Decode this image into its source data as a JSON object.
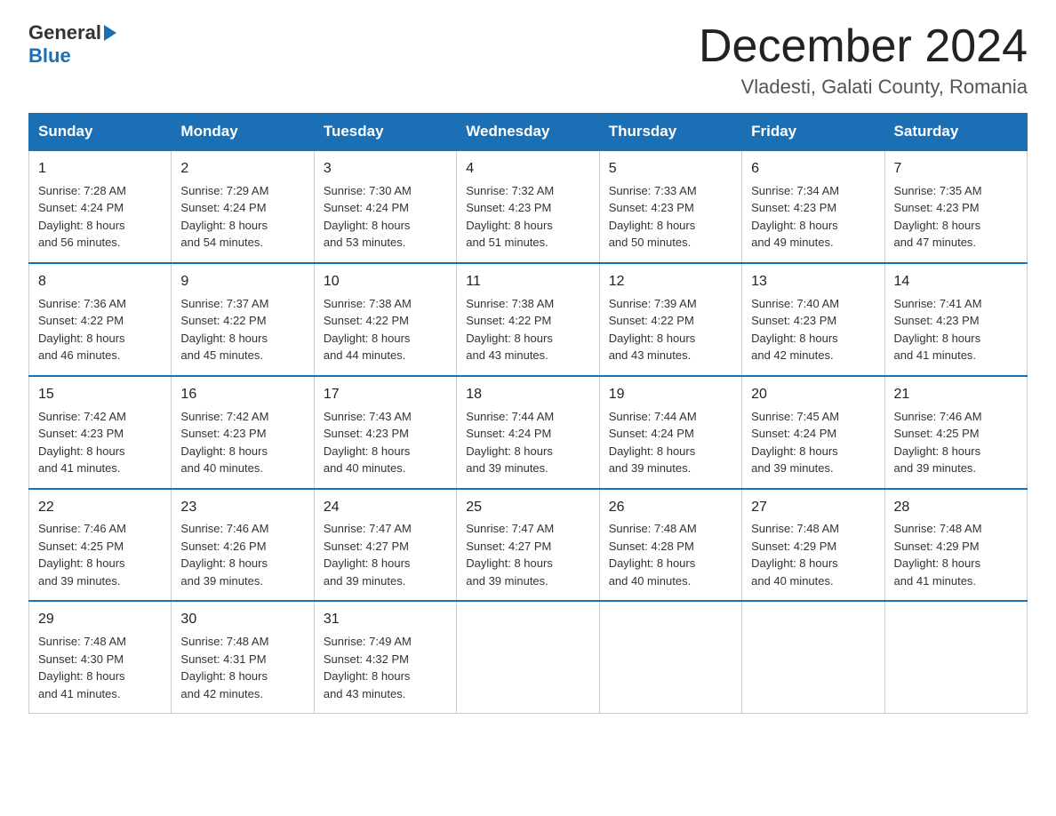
{
  "header": {
    "logo_general": "General",
    "logo_blue": "Blue",
    "month_title": "December 2024",
    "location": "Vladesti, Galati County, Romania"
  },
  "days_of_week": [
    "Sunday",
    "Monday",
    "Tuesday",
    "Wednesday",
    "Thursday",
    "Friday",
    "Saturday"
  ],
  "weeks": [
    [
      {
        "day": "1",
        "sunrise": "7:28 AM",
        "sunset": "4:24 PM",
        "daylight": "8 hours and 56 minutes."
      },
      {
        "day": "2",
        "sunrise": "7:29 AM",
        "sunset": "4:24 PM",
        "daylight": "8 hours and 54 minutes."
      },
      {
        "day": "3",
        "sunrise": "7:30 AM",
        "sunset": "4:24 PM",
        "daylight": "8 hours and 53 minutes."
      },
      {
        "day": "4",
        "sunrise": "7:32 AM",
        "sunset": "4:23 PM",
        "daylight": "8 hours and 51 minutes."
      },
      {
        "day": "5",
        "sunrise": "7:33 AM",
        "sunset": "4:23 PM",
        "daylight": "8 hours and 50 minutes."
      },
      {
        "day": "6",
        "sunrise": "7:34 AM",
        "sunset": "4:23 PM",
        "daylight": "8 hours and 49 minutes."
      },
      {
        "day": "7",
        "sunrise": "7:35 AM",
        "sunset": "4:23 PM",
        "daylight": "8 hours and 47 minutes."
      }
    ],
    [
      {
        "day": "8",
        "sunrise": "7:36 AM",
        "sunset": "4:22 PM",
        "daylight": "8 hours and 46 minutes."
      },
      {
        "day": "9",
        "sunrise": "7:37 AM",
        "sunset": "4:22 PM",
        "daylight": "8 hours and 45 minutes."
      },
      {
        "day": "10",
        "sunrise": "7:38 AM",
        "sunset": "4:22 PM",
        "daylight": "8 hours and 44 minutes."
      },
      {
        "day": "11",
        "sunrise": "7:38 AM",
        "sunset": "4:22 PM",
        "daylight": "8 hours and 43 minutes."
      },
      {
        "day": "12",
        "sunrise": "7:39 AM",
        "sunset": "4:22 PM",
        "daylight": "8 hours and 43 minutes."
      },
      {
        "day": "13",
        "sunrise": "7:40 AM",
        "sunset": "4:23 PM",
        "daylight": "8 hours and 42 minutes."
      },
      {
        "day": "14",
        "sunrise": "7:41 AM",
        "sunset": "4:23 PM",
        "daylight": "8 hours and 41 minutes."
      }
    ],
    [
      {
        "day": "15",
        "sunrise": "7:42 AM",
        "sunset": "4:23 PM",
        "daylight": "8 hours and 41 minutes."
      },
      {
        "day": "16",
        "sunrise": "7:42 AM",
        "sunset": "4:23 PM",
        "daylight": "8 hours and 40 minutes."
      },
      {
        "day": "17",
        "sunrise": "7:43 AM",
        "sunset": "4:23 PM",
        "daylight": "8 hours and 40 minutes."
      },
      {
        "day": "18",
        "sunrise": "7:44 AM",
        "sunset": "4:24 PM",
        "daylight": "8 hours and 39 minutes."
      },
      {
        "day": "19",
        "sunrise": "7:44 AM",
        "sunset": "4:24 PM",
        "daylight": "8 hours and 39 minutes."
      },
      {
        "day": "20",
        "sunrise": "7:45 AM",
        "sunset": "4:24 PM",
        "daylight": "8 hours and 39 minutes."
      },
      {
        "day": "21",
        "sunrise": "7:46 AM",
        "sunset": "4:25 PM",
        "daylight": "8 hours and 39 minutes."
      }
    ],
    [
      {
        "day": "22",
        "sunrise": "7:46 AM",
        "sunset": "4:25 PM",
        "daylight": "8 hours and 39 minutes."
      },
      {
        "day": "23",
        "sunrise": "7:46 AM",
        "sunset": "4:26 PM",
        "daylight": "8 hours and 39 minutes."
      },
      {
        "day": "24",
        "sunrise": "7:47 AM",
        "sunset": "4:27 PM",
        "daylight": "8 hours and 39 minutes."
      },
      {
        "day": "25",
        "sunrise": "7:47 AM",
        "sunset": "4:27 PM",
        "daylight": "8 hours and 39 minutes."
      },
      {
        "day": "26",
        "sunrise": "7:48 AM",
        "sunset": "4:28 PM",
        "daylight": "8 hours and 40 minutes."
      },
      {
        "day": "27",
        "sunrise": "7:48 AM",
        "sunset": "4:29 PM",
        "daylight": "8 hours and 40 minutes."
      },
      {
        "day": "28",
        "sunrise": "7:48 AM",
        "sunset": "4:29 PM",
        "daylight": "8 hours and 41 minutes."
      }
    ],
    [
      {
        "day": "29",
        "sunrise": "7:48 AM",
        "sunset": "4:30 PM",
        "daylight": "8 hours and 41 minutes."
      },
      {
        "day": "30",
        "sunrise": "7:48 AM",
        "sunset": "4:31 PM",
        "daylight": "8 hours and 42 minutes."
      },
      {
        "day": "31",
        "sunrise": "7:49 AM",
        "sunset": "4:32 PM",
        "daylight": "8 hours and 43 minutes."
      },
      null,
      null,
      null,
      null
    ]
  ],
  "labels": {
    "sunrise": "Sunrise:",
    "sunset": "Sunset:",
    "daylight": "Daylight:"
  }
}
